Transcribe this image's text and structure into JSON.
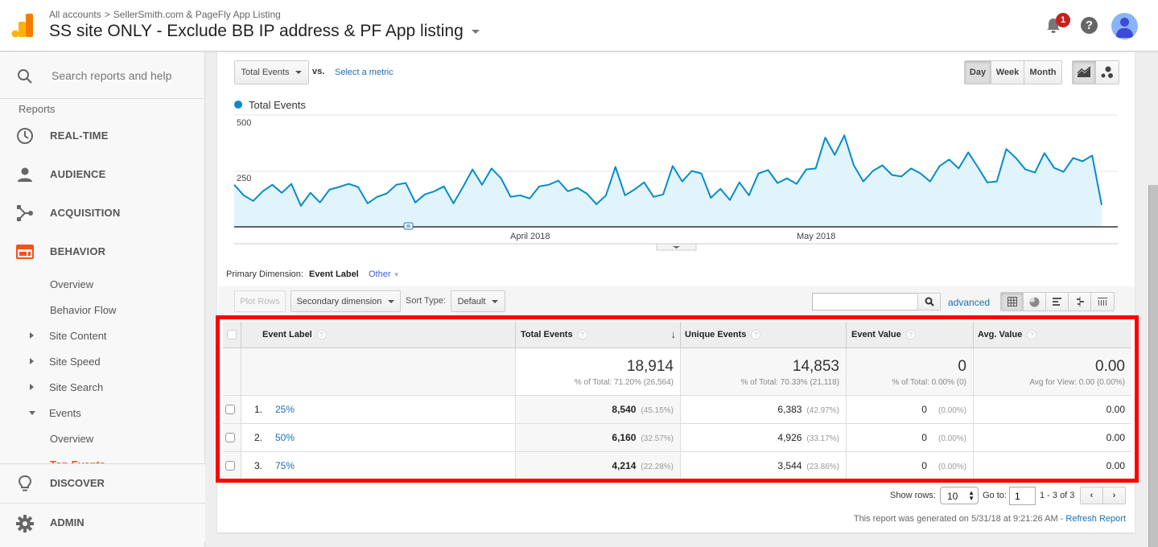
{
  "header": {
    "breadcrumb": [
      "All accounts",
      "SellerSmith.com & PageFly App Listing"
    ],
    "breadcrumb_separator": ">",
    "view_title": "SS site ONLY - Exclude BB IP address & PF App listing",
    "notification_count": "1",
    "help_glyph": "?"
  },
  "sidebar": {
    "search_placeholder": "Search reports and help",
    "section_label": "Reports",
    "main_items": [
      {
        "label": "REAL-TIME",
        "icon": "clock-icon"
      },
      {
        "label": "AUDIENCE",
        "icon": "person-icon"
      },
      {
        "label": "ACQUISITION",
        "icon": "acquisition-icon"
      },
      {
        "label": "BEHAVIOR",
        "icon": "behavior-icon",
        "active": true
      }
    ],
    "behavior_sub": [
      {
        "label": "Overview"
      },
      {
        "label": "Behavior Flow"
      },
      {
        "label": "Site Content",
        "expandable": true
      },
      {
        "label": "Site Speed",
        "expandable": true
      },
      {
        "label": "Site Search",
        "expandable": true
      },
      {
        "label": "Events",
        "expanded": true
      }
    ],
    "events_sub": [
      {
        "label": "Overview"
      },
      {
        "label": "Top Events",
        "active": true
      }
    ],
    "bottom_items": [
      {
        "label": "DISCOVER",
        "icon": "lightbulb-icon"
      },
      {
        "label": "ADMIN",
        "icon": "gear-icon"
      }
    ],
    "accent_color": "#f4511e"
  },
  "chart_controls": {
    "metric_select": "Total Events",
    "vs_label": "vs.",
    "select_metric_link": "Select a metric",
    "period_buttons": [
      "Day",
      "Week",
      "Month"
    ],
    "active_period": "Day"
  },
  "chart_data": {
    "type": "area",
    "title": "",
    "legend": [
      {
        "name": "Total Events",
        "color": "#058dc7"
      }
    ],
    "legend_position": "top-left",
    "x_tick_labels": [
      "April 2018",
      "May 2018"
    ],
    "y_tick_labels": [
      "500",
      "250"
    ],
    "ylim": [
      0,
      500
    ],
    "grid": true,
    "series": [
      {
        "name": "Total Events",
        "color": "#058dc7",
        "fill": "#e1f3fb",
        "values": [
          188,
          141,
          116,
          159,
          188,
          152,
          192,
          94,
          152,
          109,
          167,
          178,
          192,
          178,
          105,
          134,
          149,
          188,
          196,
          109,
          145,
          159,
          181,
          105,
          178,
          257,
          188,
          261,
          217,
          134,
          141,
          127,
          181,
          188,
          207,
          159,
          174,
          149,
          101,
          141,
          268,
          141,
          167,
          199,
          134,
          145,
          272,
          203,
          250,
          239,
          130,
          170,
          120,
          199,
          141,
          239,
          254,
          196,
          217,
          192,
          257,
          261,
          399,
          322,
          409,
          275,
          203,
          250,
          275,
          232,
          225,
          261,
          239,
          203,
          272,
          301,
          261,
          333,
          268,
          199,
          203,
          348,
          308,
          257,
          243,
          330,
          264,
          246,
          308,
          293,
          319,
          98
        ]
      }
    ]
  },
  "dimension": {
    "primary_label": "Primary Dimension:",
    "primary_value": "Event Label",
    "other_link": "Other"
  },
  "toolbar": {
    "plot_rows": "Plot Rows",
    "secondary_dimension": "Secondary dimension",
    "sort_type_label": "Sort Type:",
    "sort_type_value": "Default",
    "search_value": "",
    "advanced_link": "advanced"
  },
  "table": {
    "headers": [
      "Event Label",
      "Total Events",
      "Unique Events",
      "Event Value",
      "Avg. Value"
    ],
    "sorted_column": "Total Events",
    "summary": {
      "total_events": "18,914",
      "total_events_sub": "% of Total: 71.20% (26,564)",
      "unique_events": "14,853",
      "unique_events_sub": "% of Total: 70.33% (21,118)",
      "event_value": "0",
      "event_value_sub": "% of Total: 0.00% (0)",
      "avg_value": "0.00",
      "avg_value_sub": "Avg for View: 0.00 (0.00%)"
    },
    "rows": [
      {
        "index": "1.",
        "label": "25%",
        "total_events": "8,540",
        "total_pct": "(45.15%)",
        "unique_events": "6,383",
        "unique_pct": "(42.97%)",
        "event_value": "0",
        "event_value_pct": "(0.00%)",
        "avg_value": "0.00"
      },
      {
        "index": "2.",
        "label": "50%",
        "total_events": "6,160",
        "total_pct": "(32.57%)",
        "unique_events": "4,926",
        "unique_pct": "(33.17%)",
        "event_value": "0",
        "event_value_pct": "(0.00%)",
        "avg_value": "0.00"
      },
      {
        "index": "3.",
        "label": "75%",
        "total_events": "4,214",
        "total_pct": "(22.28%)",
        "unique_events": "3,544",
        "unique_pct": "(23.86%)",
        "event_value": "0",
        "event_value_pct": "(0.00%)",
        "avg_value": "0.00"
      }
    ]
  },
  "pagination": {
    "show_rows_label": "Show rows:",
    "show_rows_value": "10",
    "goto_label": "Go to:",
    "goto_value": "1",
    "range_text": "1 - 3 of 3"
  },
  "footer": {
    "generated_text": "This report was generated on 5/31/18 at 9:21:26 AM - ",
    "refresh_link": "Refresh Report"
  },
  "highlight_color": "#ff0000"
}
